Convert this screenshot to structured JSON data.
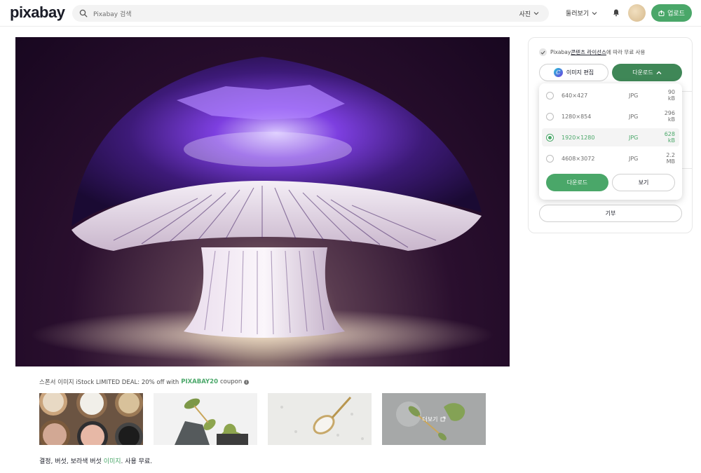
{
  "header": {
    "logo": "pixabay",
    "search_placeholder": "Pixabay 검색",
    "search_filter": "사진",
    "explore": "둘러보기",
    "upload": "업로드"
  },
  "sponsor": {
    "prefix": "스폰서 이미지 iStock LIMITED DEAL: 20% off with",
    "code": "PIXABAY20",
    "suffix": "coupon",
    "info": "i",
    "more_label": "더보기"
  },
  "caption": {
    "before": "결정, 버섯, 보라색 버섯 ",
    "highlight": "이미지",
    "after": ". 사용 무료."
  },
  "panel": {
    "license_prefix": "Pixabay ",
    "license_link": "콘텐츠 라이선스",
    "license_suffix": "에 따라 무료 사용",
    "edit_label": "이미지 편집",
    "canva_letter": "C",
    "download_toggle": "다운로드",
    "donate": "기부"
  },
  "download_options": [
    {
      "res": "640×427",
      "fmt": "JPG",
      "size": "90 kB",
      "selected": false
    },
    {
      "res": "1280×854",
      "fmt": "JPG",
      "size": "296 kB",
      "selected": false
    },
    {
      "res": "1920×1280",
      "fmt": "JPG",
      "size": "628 kB",
      "selected": true
    },
    {
      "res": "4608×3072",
      "fmt": "JPG",
      "size": "2.2 MB",
      "selected": false
    }
  ],
  "dropdown": {
    "download": "다운로드",
    "view": "보기"
  },
  "colors": {
    "accent": "#4aa769",
    "accent_dark": "#3f8757"
  }
}
